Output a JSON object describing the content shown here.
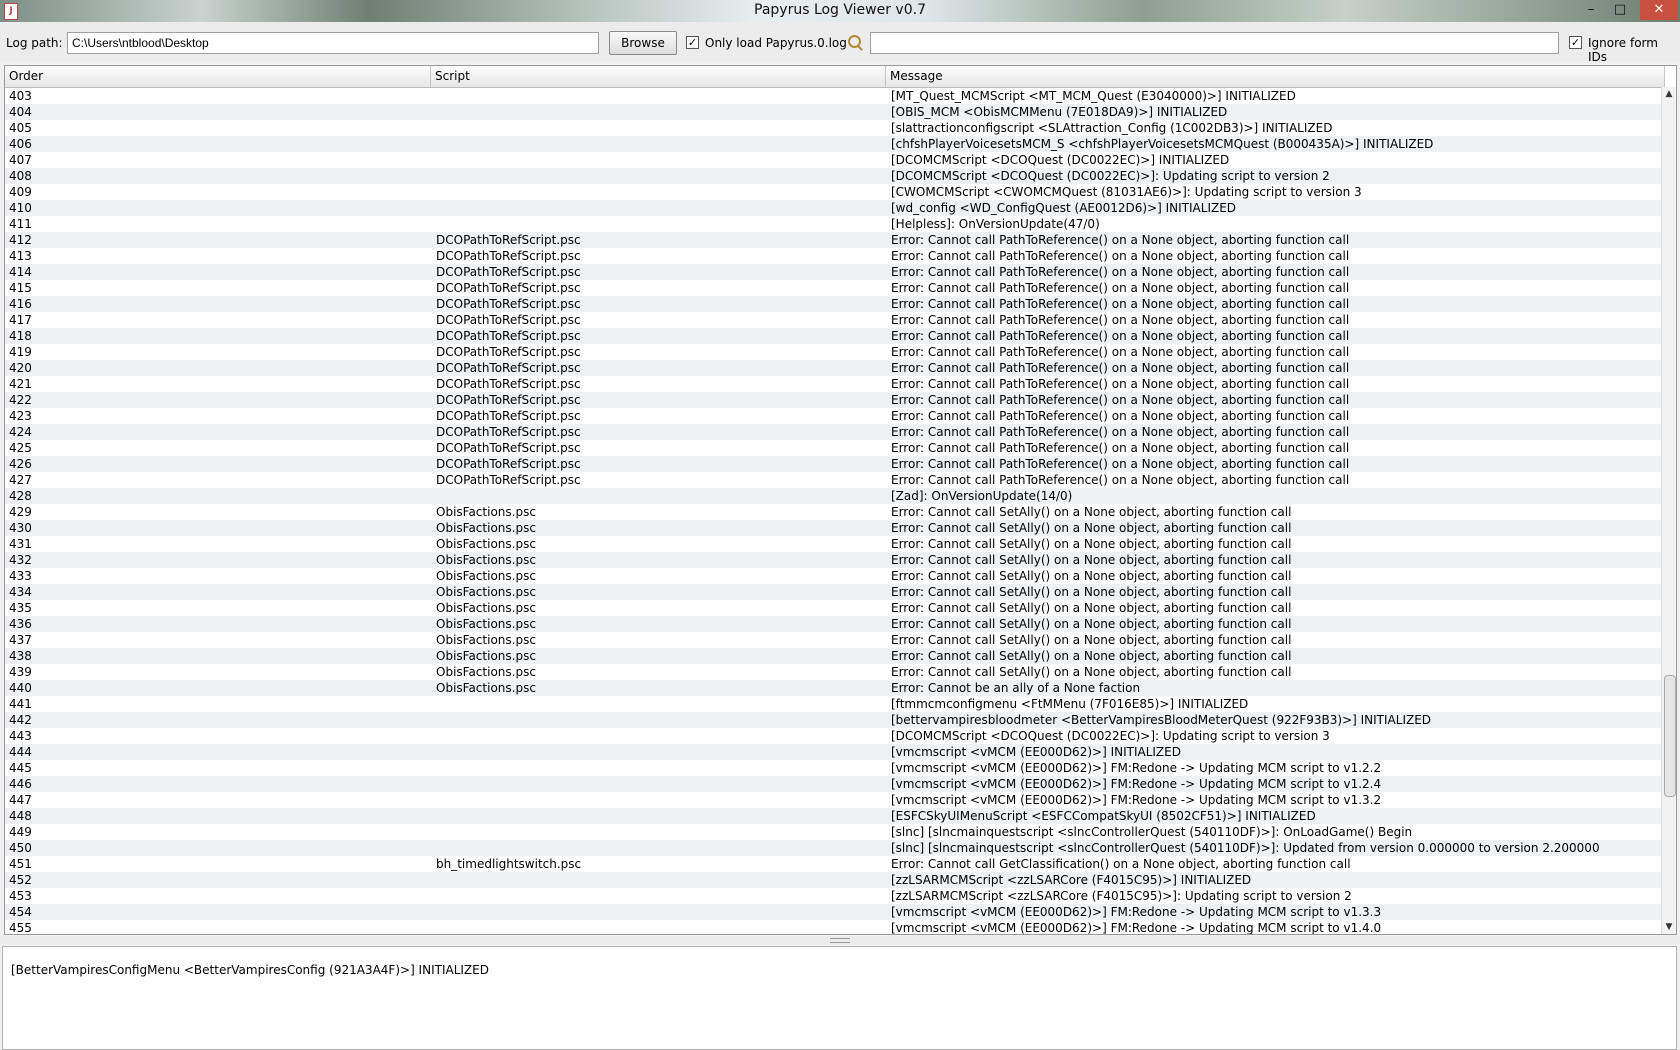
{
  "window": {
    "title": "Papyrus Log Viewer v0.7",
    "icon": "java-icon",
    "controls": {
      "minimize": "–",
      "maximize": "□",
      "close": "✕"
    }
  },
  "toolbar": {
    "log_path_label": "Log path:",
    "log_path_value": "C:\\Users\\ntblood\\Desktop",
    "browse_label": "Browse",
    "only_load_label": "Only load Papyrus.0.log",
    "only_load_checked": true,
    "search_icon": "search-icon",
    "search_value": "",
    "ignore_ids_label": "Ignore form IDs",
    "ignore_ids_checked": true
  },
  "table": {
    "columns": [
      "Order",
      "Script",
      "Message"
    ],
    "rows": [
      [
        "403",
        "",
        "[MT_Quest_MCMScript <MT_MCM_Quest (E3040000)>] INITIALIZED"
      ],
      [
        "404",
        "",
        "[OBIS_MCM <ObisMCMMenu (7E018DA9)>] INITIALIZED"
      ],
      [
        "405",
        "",
        "[slattractionconfigscript <SLAttraction_Config (1C002DB3)>] INITIALIZED"
      ],
      [
        "406",
        "",
        "[chfshPlayerVoicesetsMCM_S <chfshPlayerVoicesetsMCMQuest (B000435A)>] INITIALIZED"
      ],
      [
        "407",
        "",
        "[DCOMCMScript <DCOQuest (DC0022EC)>] INITIALIZED"
      ],
      [
        "408",
        "",
        "[DCOMCMScript <DCOQuest (DC0022EC)>]: Updating script to version 2"
      ],
      [
        "409",
        "",
        "[CWOMCMScript <CWOMCMQuest (81031AE6)>]: Updating script to version 3"
      ],
      [
        "410",
        "",
        "[wd_config <WD_ConfigQuest (AE0012D6)>] INITIALIZED"
      ],
      [
        "411",
        "",
        "[Helpless]: OnVersionUpdate(47/0)"
      ],
      [
        "412",
        "DCOPathToRefScript.psc",
        "Error: Cannot call PathToReference() on a None object, aborting function call"
      ],
      [
        "413",
        "DCOPathToRefScript.psc",
        "Error: Cannot call PathToReference() on a None object, aborting function call"
      ],
      [
        "414",
        "DCOPathToRefScript.psc",
        "Error: Cannot call PathToReference() on a None object, aborting function call"
      ],
      [
        "415",
        "DCOPathToRefScript.psc",
        "Error: Cannot call PathToReference() on a None object, aborting function call"
      ],
      [
        "416",
        "DCOPathToRefScript.psc",
        "Error: Cannot call PathToReference() on a None object, aborting function call"
      ],
      [
        "417",
        "DCOPathToRefScript.psc",
        "Error: Cannot call PathToReference() on a None object, aborting function call"
      ],
      [
        "418",
        "DCOPathToRefScript.psc",
        "Error: Cannot call PathToReference() on a None object, aborting function call"
      ],
      [
        "419",
        "DCOPathToRefScript.psc",
        "Error: Cannot call PathToReference() on a None object, aborting function call"
      ],
      [
        "420",
        "DCOPathToRefScript.psc",
        "Error: Cannot call PathToReference() on a None object, aborting function call"
      ],
      [
        "421",
        "DCOPathToRefScript.psc",
        "Error: Cannot call PathToReference() on a None object, aborting function call"
      ],
      [
        "422",
        "DCOPathToRefScript.psc",
        "Error: Cannot call PathToReference() on a None object, aborting function call"
      ],
      [
        "423",
        "DCOPathToRefScript.psc",
        "Error: Cannot call PathToReference() on a None object, aborting function call"
      ],
      [
        "424",
        "DCOPathToRefScript.psc",
        "Error: Cannot call PathToReference() on a None object, aborting function call"
      ],
      [
        "425",
        "DCOPathToRefScript.psc",
        "Error: Cannot call PathToReference() on a None object, aborting function call"
      ],
      [
        "426",
        "DCOPathToRefScript.psc",
        "Error: Cannot call PathToReference() on a None object, aborting function call"
      ],
      [
        "427",
        "DCOPathToRefScript.psc",
        "Error: Cannot call PathToReference() on a None object, aborting function call"
      ],
      [
        "428",
        "",
        "[Zad]: OnVersionUpdate(14/0)"
      ],
      [
        "429",
        "ObisFactions.psc",
        "Error: Cannot call SetAlly() on a None object, aborting function call"
      ],
      [
        "430",
        "ObisFactions.psc",
        "Error: Cannot call SetAlly() on a None object, aborting function call"
      ],
      [
        "431",
        "ObisFactions.psc",
        "Error: Cannot call SetAlly() on a None object, aborting function call"
      ],
      [
        "432",
        "ObisFactions.psc",
        "Error: Cannot call SetAlly() on a None object, aborting function call"
      ],
      [
        "433",
        "ObisFactions.psc",
        "Error: Cannot call SetAlly() on a None object, aborting function call"
      ],
      [
        "434",
        "ObisFactions.psc",
        "Error: Cannot call SetAlly() on a None object, aborting function call"
      ],
      [
        "435",
        "ObisFactions.psc",
        "Error: Cannot call SetAlly() on a None object, aborting function call"
      ],
      [
        "436",
        "ObisFactions.psc",
        "Error: Cannot call SetAlly() on a None object, aborting function call"
      ],
      [
        "437",
        "ObisFactions.psc",
        "Error: Cannot call SetAlly() on a None object, aborting function call"
      ],
      [
        "438",
        "ObisFactions.psc",
        "Error: Cannot call SetAlly() on a None object, aborting function call"
      ],
      [
        "439",
        "ObisFactions.psc",
        "Error: Cannot call SetAlly() on a None object, aborting function call"
      ],
      [
        "440",
        "ObisFactions.psc",
        "Error: Cannot be an ally of a None faction"
      ],
      [
        "441",
        "",
        "[ftmmcmconfigmenu <FtMMenu (7F016E85)>] INITIALIZED"
      ],
      [
        "442",
        "",
        "[bettervampiresbloodmeter <BetterVampiresBloodMeterQuest (922F93B3)>] INITIALIZED"
      ],
      [
        "443",
        "",
        "[DCOMCMScript <DCOQuest (DC0022EC)>]: Updating script to version 3"
      ],
      [
        "444",
        "",
        "[vmcmscript <vMCM (EE000D62)>] INITIALIZED"
      ],
      [
        "445",
        "",
        "[vmcmscript <vMCM (EE000D62)>] FM:Redone -> Updating MCM script to v1.2.2"
      ],
      [
        "446",
        "",
        "[vmcmscript <vMCM (EE000D62)>] FM:Redone -> Updating MCM script to v1.2.4"
      ],
      [
        "447",
        "",
        "[vmcmscript <vMCM (EE000D62)>] FM:Redone -> Updating MCM script to v1.3.2"
      ],
      [
        "448",
        "",
        "[ESFCSkyUIMenuScript <ESFCCompatSkyUI (8502CF51)>] INITIALIZED"
      ],
      [
        "449",
        "",
        "[slnc] [slncmainquestscript <slncControllerQuest (540110DF)>]: OnLoadGame() Begin"
      ],
      [
        "450",
        "",
        "[slnc] [slncmainquestscript <slncControllerQuest (540110DF)>]: Updated from version 0.000000 to version 2.200000"
      ],
      [
        "451",
        "bh_timedlightswitch.psc",
        "Error: Cannot call GetClassification() on a None object, aborting function call"
      ],
      [
        "452",
        "",
        "[zzLSARMCMScript <zzLSARCore (F4015C95)>] INITIALIZED"
      ],
      [
        "453",
        "",
        "[zzLSARMCMScript <zzLSARCore (F4015C95)>]: Updating script to version 2"
      ],
      [
        "454",
        "",
        "[vmcmscript <vMCM (EE000D62)>] FM:Redone -> Updating MCM script to v1.3.3"
      ],
      [
        "455",
        "",
        "[vmcmscript <vMCM (EE000D62)>] FM:Redone -> Updating MCM script to v1.4.0"
      ]
    ]
  },
  "detail": {
    "text": "[BetterVampiresConfigMenu <BetterVampiresConfig (921A3A4F)>] INITIALIZED"
  }
}
